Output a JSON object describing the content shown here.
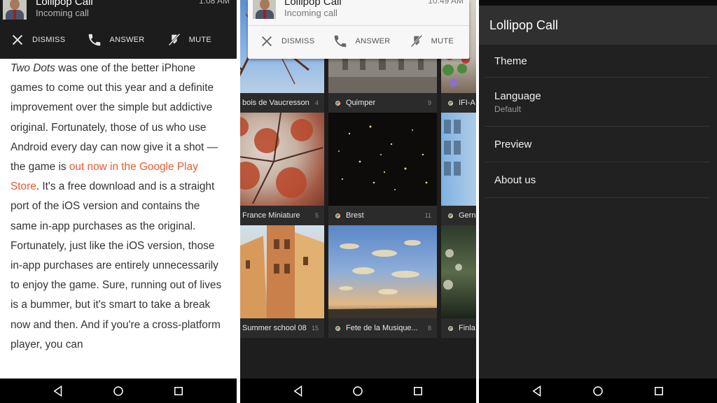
{
  "notification": {
    "title": "Lollipop Call",
    "subtitle": "Incoming call",
    "time_dark": "1:08 AM",
    "time_light": "10:49 AM",
    "actions": [
      {
        "label": "DISMISS",
        "icon": "close-icon"
      },
      {
        "label": "ANSWER",
        "icon": "phone-icon"
      },
      {
        "label": "MUTE",
        "icon": "mute-icon"
      }
    ]
  },
  "article": {
    "game_title": "Two Dots",
    "part1": " was one of the better iPhone games to come out this year and a definite improvement over the simple but addictive original. Fortunately, those of us who use Android every day can now give it a shot — the game is ",
    "link": "out now in the Google Play Store",
    "part2": ". It's a free download and is a straight port of the iOS version and contains the same in-app purchases as the original. Fortunately, just like the iOS version, those in-app purchases are entirely unnecessarily to enjoy the game. Sure, running out of lives is a bummer, but it's smart to take a break now and then. And if you're a cross-platform player, you can",
    "link_color": "#ec5a2e"
  },
  "gallery": {
    "albums": [
      {
        "name": "bois de Vaucresson",
        "count": "4"
      },
      {
        "name": "Quimper",
        "count": "9"
      },
      {
        "name": "IFI-A",
        "count": ""
      },
      {
        "name": "France Miniature",
        "count": "5"
      },
      {
        "name": "Brest",
        "count": "11"
      },
      {
        "name": "Gern",
        "count": ""
      },
      {
        "name": "Summer school 08",
        "count": "15"
      },
      {
        "name": "Fete de la Musique...",
        "count": "8"
      },
      {
        "name": "Finla",
        "count": ""
      }
    ]
  },
  "settings_app": {
    "title": "Lollipop Call",
    "items": [
      {
        "title": "Theme",
        "subtitle": ""
      },
      {
        "title": "Language",
        "subtitle": "Default"
      },
      {
        "title": "Preview",
        "subtitle": ""
      },
      {
        "title": "About us",
        "subtitle": ""
      }
    ]
  },
  "navbar": {
    "icons": [
      "back-icon",
      "home-icon",
      "recents-icon"
    ]
  }
}
